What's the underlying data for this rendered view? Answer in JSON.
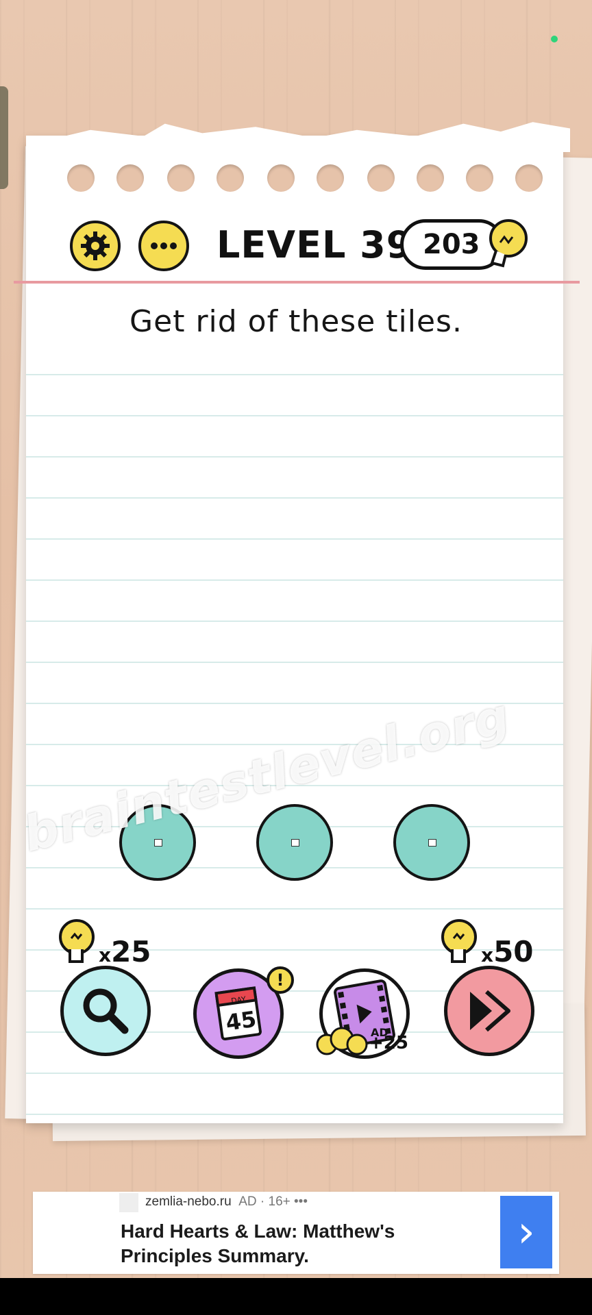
{
  "header": {
    "settings_icon": "gear-icon",
    "menu_icon": "more-dots-icon",
    "level_title": "LEVEL 399",
    "hint_count": "203",
    "hint_icon": "lightbulb-icon"
  },
  "puzzle": {
    "instruction": "Get rid of these tiles.",
    "tiles": [
      {
        "id": "tile-1"
      },
      {
        "id": "tile-2"
      },
      {
        "id": "tile-3"
      }
    ]
  },
  "watermark": "braintestlevel.org",
  "bottom_bar": {
    "hint_cost_prefix": "x",
    "hint_cost": "25",
    "skip_cost_prefix": "x",
    "skip_cost": "50",
    "daily_day_label": "DAY",
    "daily_day_number": "45",
    "daily_alert": "!",
    "ad_label": "AD",
    "ad_reward": "+25"
  },
  "ad_banner": {
    "domain": "zemlia-nebo.ru",
    "tag": "AD · 16+ •••",
    "title": "Hard Hearts & Law: Matthew's Principles Summary.",
    "arrow": "›"
  },
  "colors": {
    "yellow": "#f5dc52",
    "tile": "#86d4c8",
    "skip": "#f29aa0",
    "daily": "#d39cf0",
    "hint_btn": "#bff0f0",
    "ad_arrow": "#3f7ff0"
  }
}
